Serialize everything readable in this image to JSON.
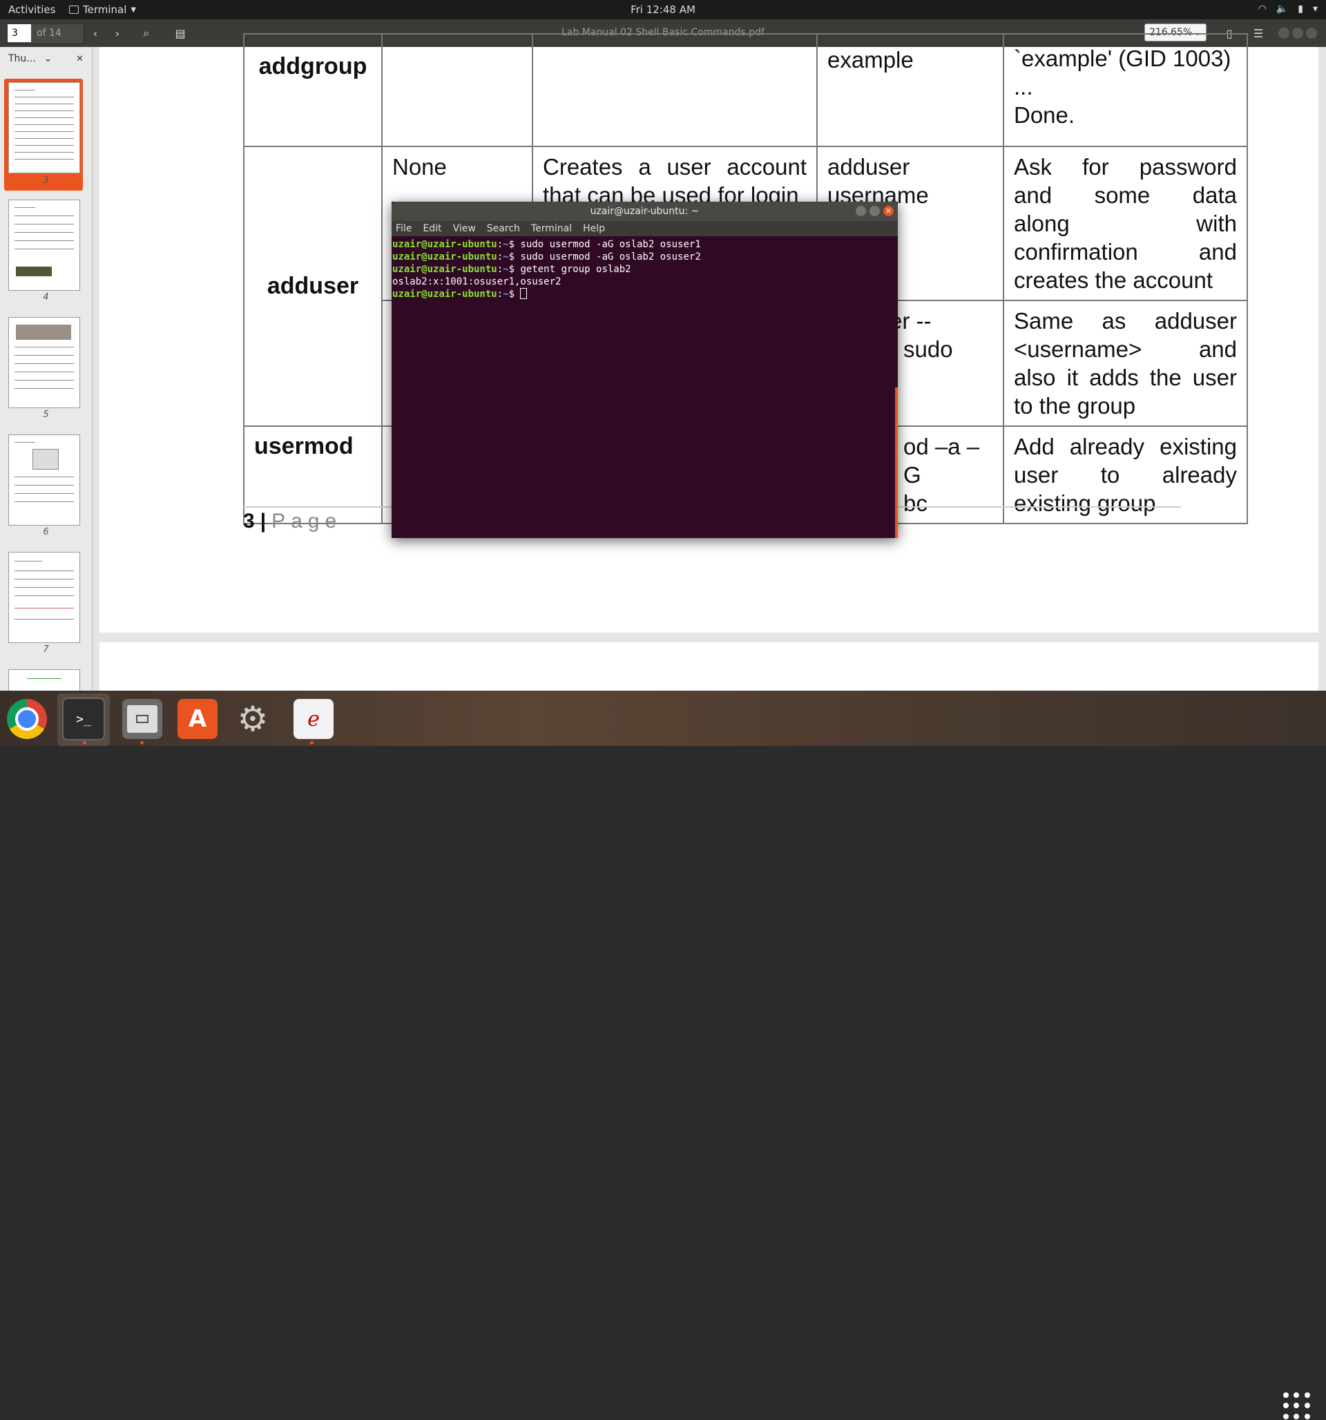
{
  "topbar": {
    "activities": "Activities",
    "app_name": "Terminal",
    "clock": "Fri 12:48 AM"
  },
  "viewer": {
    "page_current": "3",
    "page_total": "of 14",
    "document_title": "Lab Manual 02 Shell Basic Commands.pdf",
    "zoom": "216.65%"
  },
  "sidebar": {
    "mode_label": "Thu...",
    "thumbnails": [
      "3",
      "4",
      "5",
      "6",
      "7"
    ]
  },
  "table": {
    "rows": [
      {
        "cmd": "addgroup",
        "opt": "",
        "desc": "",
        "example": "example",
        "output": [
          "`example' (GID 1003)",
          "...",
          "Done."
        ]
      },
      {
        "cmd": "adduser",
        "opt": "None",
        "desc": [
          "Creates a user account",
          "that can be used for login"
        ],
        "example": [
          "adduser",
          "username"
        ],
        "output": [
          "Ask for password",
          "and some data",
          "along with",
          "confirmation and",
          "creates the account"
        ]
      },
      {
        "cmd": "",
        "opt": "",
        "desc": "",
        "example": [
          "er --",
          "sudo"
        ],
        "output": [
          "Same as adduser",
          "<username> and",
          "also it adds the user",
          "to the group"
        ]
      },
      {
        "cmd": "usermod",
        "opt": "",
        "desc": "",
        "example": [
          "od –a –G",
          "bc"
        ],
        "output": [
          "Add already existing",
          "user to already",
          "existing group"
        ]
      }
    ],
    "page_footer_num": "3",
    "page_footer_bar": "|",
    "page_footer_word": "Page"
  },
  "terminal": {
    "title": "uzair@uzair-ubuntu: ~",
    "menu": [
      "File",
      "Edit",
      "View",
      "Search",
      "Terminal",
      "Help"
    ],
    "prompt_user": "uzair@uzair-ubuntu",
    "prompt_sep": ":",
    "prompt_path": "~",
    "prompt_sym": "$ ",
    "lines": [
      {
        "type": "cmd",
        "text": "sudo usermod -aG oslab2 osuser1"
      },
      {
        "type": "cmd",
        "text": "sudo usermod -aG oslab2 osuser2"
      },
      {
        "type": "cmd",
        "text": "getent group oslab2"
      },
      {
        "type": "out",
        "text": "oslab2:x:1001:osuser1,osuser2"
      },
      {
        "type": "cmd",
        "text": ""
      }
    ]
  },
  "dock": {
    "items": [
      "chrome-icon",
      "terminal-icon",
      "files-icon",
      "software-icon",
      "settings-icon",
      "document-viewer-icon"
    ],
    "terminal_glyph": ">_",
    "software_glyph": "A",
    "settings_glyph": "⚙",
    "reader_glyph": "ℯ"
  },
  "colors": {
    "accent": "#e95420",
    "terminal_bg": "#300a24",
    "prompt_green": "#8ae234",
    "path_blue": "#729fcf"
  }
}
